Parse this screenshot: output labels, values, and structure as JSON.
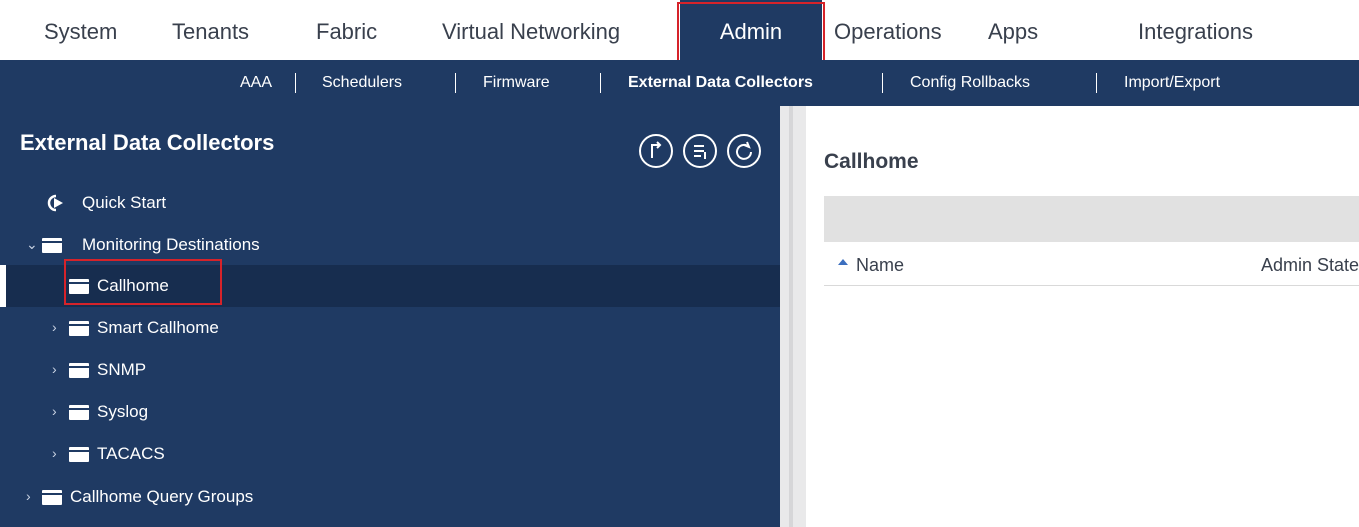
{
  "top_tabs": [
    {
      "label": "System"
    },
    {
      "label": "Tenants"
    },
    {
      "label": "Fabric"
    },
    {
      "label": "Virtual Networking"
    },
    {
      "label": "Admin",
      "active": true
    },
    {
      "label": "Operations"
    },
    {
      "label": "Apps"
    },
    {
      "label": "Integrations"
    }
  ],
  "sub_tabs": [
    {
      "label": "AAA"
    },
    {
      "label": "Schedulers"
    },
    {
      "label": "Firmware"
    },
    {
      "label": "External Data Collectors",
      "active": true
    },
    {
      "label": "Config Rollbacks"
    },
    {
      "label": "Import/Export"
    }
  ],
  "left_panel": {
    "title": "External Data Collectors",
    "action_icons": [
      "collapse-up-icon",
      "filter-list-icon",
      "refresh-icon"
    ],
    "tree": [
      {
        "label": "Quick Start",
        "icon": "quick-start-icon"
      },
      {
        "label": "Monitoring Destinations",
        "icon": "folder-icon",
        "expanded": true
      },
      {
        "label": "Callhome",
        "icon": "folder-icon",
        "selected": true
      },
      {
        "label": "Smart Callhome",
        "icon": "folder-icon",
        "expanded": false
      },
      {
        "label": "SNMP",
        "icon": "folder-icon",
        "expanded": false
      },
      {
        "label": "Syslog",
        "icon": "folder-icon",
        "expanded": false
      },
      {
        "label": "TACACS",
        "icon": "folder-icon",
        "expanded": false
      },
      {
        "label": "Callhome Query Groups",
        "icon": "folder-icon",
        "expanded": false
      }
    ]
  },
  "right_panel": {
    "title": "Callhome",
    "columns": [
      "Name",
      "Admin State"
    ]
  },
  "colors": {
    "nav_bg": "#1f3a63",
    "selected_row_bg": "#172d4f",
    "highlight_red": "#d6232a",
    "sort_arrow": "#3c6fbf"
  }
}
